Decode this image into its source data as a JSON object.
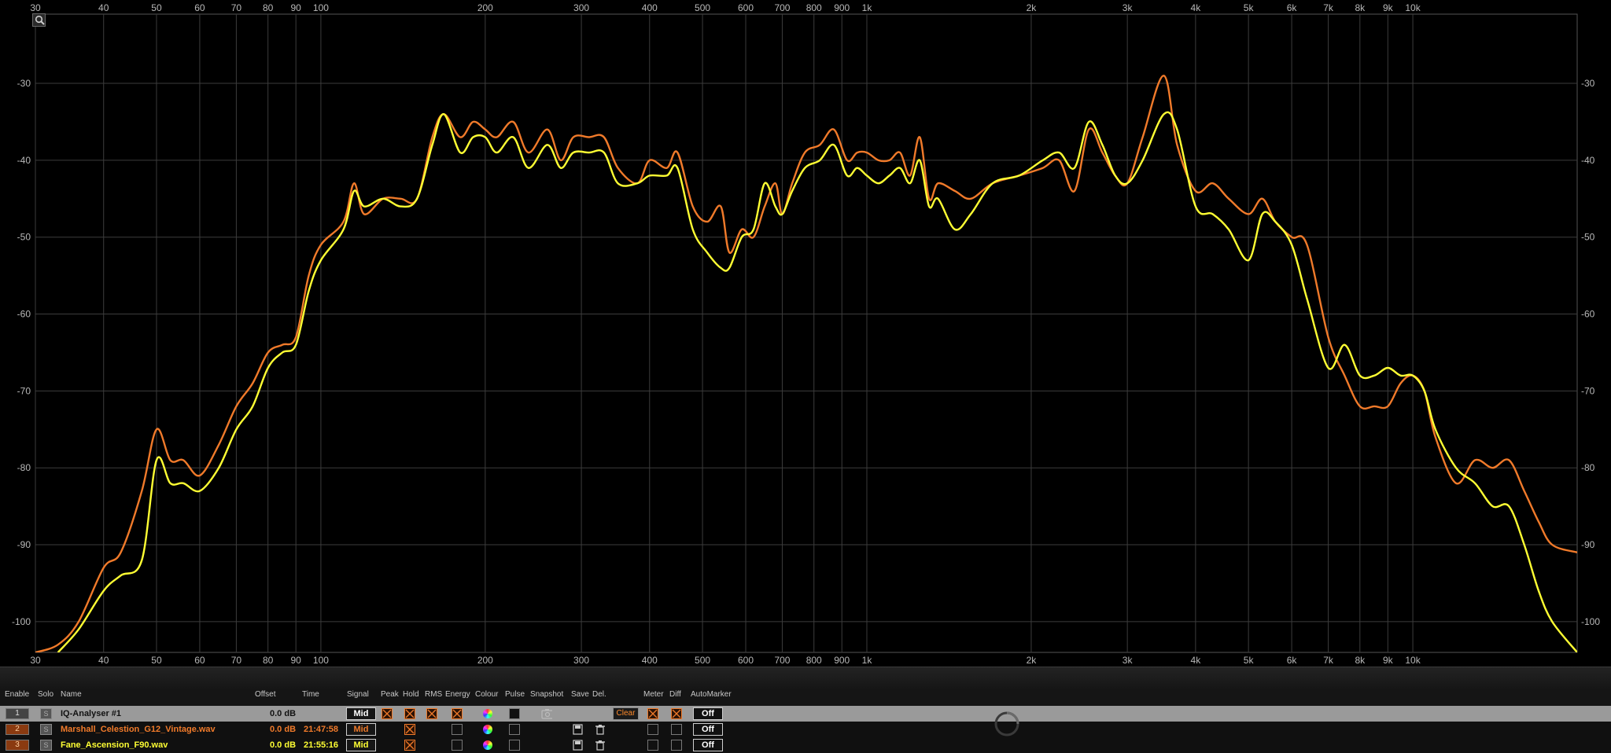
{
  "chart_data": {
    "type": "line",
    "xlabel": "",
    "ylabel": "",
    "x_scale": "log",
    "xlim": [
      30,
      20000
    ],
    "ylim": [
      -104,
      -21
    ],
    "x_ticks": [
      {
        "value": 30,
        "label": "30"
      },
      {
        "value": 40,
        "label": "40"
      },
      {
        "value": 50,
        "label": "50"
      },
      {
        "value": 60,
        "label": "60"
      },
      {
        "value": 70,
        "label": "70"
      },
      {
        "value": 80,
        "label": "80"
      },
      {
        "value": 90,
        "label": "90"
      },
      {
        "value": 100,
        "label": "100"
      },
      {
        "value": 200,
        "label": "200"
      },
      {
        "value": 300,
        "label": "300"
      },
      {
        "value": 400,
        "label": "400"
      },
      {
        "value": 500,
        "label": "500"
      },
      {
        "value": 600,
        "label": "600"
      },
      {
        "value": 700,
        "label": "700"
      },
      {
        "value": 800,
        "label": "800"
      },
      {
        "value": 900,
        "label": "900"
      },
      {
        "value": 1000,
        "label": "1k"
      },
      {
        "value": 2000,
        "label": "2k"
      },
      {
        "value": 3000,
        "label": "3k"
      },
      {
        "value": 4000,
        "label": "4k"
      },
      {
        "value": 5000,
        "label": "5k"
      },
      {
        "value": 6000,
        "label": "6k"
      },
      {
        "value": 7000,
        "label": "7k"
      },
      {
        "value": 8000,
        "label": "8k"
      },
      {
        "value": 9000,
        "label": "9k"
      },
      {
        "value": 10000,
        "label": "10k"
      }
    ],
    "y_ticks": [
      -30,
      -40,
      -50,
      -60,
      -70,
      -80,
      -90,
      -100
    ],
    "grid": true,
    "series": [
      {
        "color": "#f07a2a",
        "points": [
          [
            30,
            -104
          ],
          [
            33,
            -103
          ],
          [
            36,
            -100
          ],
          [
            40,
            -93
          ],
          [
            43,
            -91
          ],
          [
            47,
            -83
          ],
          [
            50,
            -75
          ],
          [
            53,
            -79
          ],
          [
            56,
            -79
          ],
          [
            60,
            -81
          ],
          [
            65,
            -77
          ],
          [
            70,
            -72
          ],
          [
            75,
            -69
          ],
          [
            80,
            -65
          ],
          [
            85,
            -64
          ],
          [
            90,
            -63
          ],
          [
            95,
            -55
          ],
          [
            100,
            -51
          ],
          [
            110,
            -48
          ],
          [
            115,
            -43
          ],
          [
            120,
            -47
          ],
          [
            130,
            -45
          ],
          [
            140,
            -45
          ],
          [
            150,
            -45
          ],
          [
            160,
            -37
          ],
          [
            168,
            -34
          ],
          [
            180,
            -37
          ],
          [
            190,
            -35
          ],
          [
            200,
            -36
          ],
          [
            210,
            -37
          ],
          [
            225,
            -35
          ],
          [
            240,
            -39
          ],
          [
            260,
            -36
          ],
          [
            275,
            -40
          ],
          [
            290,
            -37
          ],
          [
            310,
            -37
          ],
          [
            330,
            -37
          ],
          [
            350,
            -41
          ],
          [
            380,
            -43
          ],
          [
            400,
            -40
          ],
          [
            430,
            -41
          ],
          [
            450,
            -39
          ],
          [
            480,
            -46
          ],
          [
            510,
            -48
          ],
          [
            540,
            -46
          ],
          [
            560,
            -52
          ],
          [
            590,
            -49
          ],
          [
            620,
            -50
          ],
          [
            650,
            -46
          ],
          [
            680,
            -43
          ],
          [
            700,
            -47
          ],
          [
            730,
            -43
          ],
          [
            770,
            -39
          ],
          [
            820,
            -38
          ],
          [
            870,
            -36
          ],
          [
            920,
            -40
          ],
          [
            960,
            -39
          ],
          [
            1000,
            -39
          ],
          [
            1050,
            -40
          ],
          [
            1100,
            -40
          ],
          [
            1150,
            -39
          ],
          [
            1200,
            -42
          ],
          [
            1250,
            -37
          ],
          [
            1300,
            -45
          ],
          [
            1350,
            -43
          ],
          [
            1450,
            -44
          ],
          [
            1550,
            -45
          ],
          [
            1700,
            -43
          ],
          [
            1900,
            -42
          ],
          [
            2100,
            -41
          ],
          [
            2250,
            -40
          ],
          [
            2400,
            -44
          ],
          [
            2550,
            -36
          ],
          [
            2700,
            -39
          ],
          [
            2850,
            -42
          ],
          [
            3000,
            -43
          ],
          [
            3200,
            -37
          ],
          [
            3500,
            -29
          ],
          [
            3700,
            -38
          ],
          [
            4000,
            -44
          ],
          [
            4300,
            -43
          ],
          [
            4600,
            -45
          ],
          [
            5000,
            -47
          ],
          [
            5300,
            -45
          ],
          [
            5600,
            -48
          ],
          [
            6000,
            -50
          ],
          [
            6400,
            -51
          ],
          [
            7000,
            -63
          ],
          [
            7500,
            -68
          ],
          [
            8000,
            -72
          ],
          [
            8500,
            -72
          ],
          [
            9000,
            -72
          ],
          [
            9500,
            -69
          ],
          [
            10000,
            -68
          ],
          [
            10500,
            -70
          ],
          [
            11000,
            -76
          ],
          [
            12000,
            -82
          ],
          [
            13000,
            -79
          ],
          [
            14000,
            -80
          ],
          [
            15000,
            -79
          ],
          [
            16000,
            -83
          ],
          [
            17000,
            -87
          ],
          [
            18000,
            -90
          ],
          [
            20000,
            -91
          ]
        ]
      },
      {
        "color": "#ffff33",
        "points": [
          [
            33,
            -104
          ],
          [
            36,
            -101
          ],
          [
            40,
            -96
          ],
          [
            43,
            -94
          ],
          [
            47,
            -92
          ],
          [
            50,
            -79
          ],
          [
            53,
            -82
          ],
          [
            56,
            -82
          ],
          [
            60,
            -83
          ],
          [
            65,
            -80
          ],
          [
            70,
            -75
          ],
          [
            75,
            -72
          ],
          [
            80,
            -67
          ],
          [
            85,
            -65
          ],
          [
            90,
            -64
          ],
          [
            95,
            -57
          ],
          [
            100,
            -53
          ],
          [
            110,
            -49
          ],
          [
            115,
            -44
          ],
          [
            120,
            -46
          ],
          [
            130,
            -45
          ],
          [
            140,
            -46
          ],
          [
            150,
            -45
          ],
          [
            160,
            -38
          ],
          [
            168,
            -34
          ],
          [
            180,
            -39
          ],
          [
            190,
            -37
          ],
          [
            200,
            -37
          ],
          [
            210,
            -39
          ],
          [
            225,
            -37
          ],
          [
            240,
            -41
          ],
          [
            260,
            -38
          ],
          [
            275,
            -41
          ],
          [
            290,
            -39
          ],
          [
            310,
            -39
          ],
          [
            330,
            -39
          ],
          [
            350,
            -43
          ],
          [
            380,
            -43
          ],
          [
            400,
            -42
          ],
          [
            430,
            -42
          ],
          [
            450,
            -41
          ],
          [
            480,
            -49
          ],
          [
            510,
            -52
          ],
          [
            540,
            -54
          ],
          [
            560,
            -54
          ],
          [
            590,
            -50
          ],
          [
            620,
            -49
          ],
          [
            650,
            -43
          ],
          [
            680,
            -46
          ],
          [
            700,
            -47
          ],
          [
            730,
            -44
          ],
          [
            770,
            -41
          ],
          [
            820,
            -40
          ],
          [
            870,
            -38
          ],
          [
            920,
            -42
          ],
          [
            960,
            -41
          ],
          [
            1000,
            -42
          ],
          [
            1050,
            -43
          ],
          [
            1100,
            -42
          ],
          [
            1150,
            -41
          ],
          [
            1200,
            -43
          ],
          [
            1250,
            -40
          ],
          [
            1300,
            -46
          ],
          [
            1350,
            -45
          ],
          [
            1450,
            -49
          ],
          [
            1550,
            -47
          ],
          [
            1700,
            -43
          ],
          [
            1900,
            -42
          ],
          [
            2100,
            -40
          ],
          [
            2250,
            -39
          ],
          [
            2400,
            -41
          ],
          [
            2550,
            -35
          ],
          [
            2700,
            -38
          ],
          [
            2850,
            -42
          ],
          [
            3000,
            -43
          ],
          [
            3200,
            -40
          ],
          [
            3500,
            -34
          ],
          [
            3700,
            -36
          ],
          [
            4000,
            -46
          ],
          [
            4300,
            -47
          ],
          [
            4600,
            -49
          ],
          [
            5000,
            -53
          ],
          [
            5300,
            -47
          ],
          [
            5600,
            -48
          ],
          [
            6000,
            -51
          ],
          [
            6400,
            -58
          ],
          [
            7000,
            -67
          ],
          [
            7500,
            -64
          ],
          [
            8000,
            -68
          ],
          [
            8500,
            -68
          ],
          [
            9000,
            -67
          ],
          [
            9500,
            -68
          ],
          [
            10000,
            -68
          ],
          [
            10500,
            -70
          ],
          [
            11000,
            -75
          ],
          [
            12000,
            -80
          ],
          [
            13000,
            -82
          ],
          [
            14000,
            -85
          ],
          [
            15000,
            -85
          ],
          [
            16000,
            -90
          ],
          [
            17000,
            -96
          ],
          [
            18000,
            -100
          ],
          [
            20000,
            -104
          ]
        ]
      }
    ]
  },
  "table": {
    "headers": [
      {
        "key": "enable",
        "label": "Enable"
      },
      {
        "key": "solo",
        "label": "Solo"
      },
      {
        "key": "name",
        "label": "Name"
      },
      {
        "key": "offset",
        "label": "Offset"
      },
      {
        "key": "time",
        "label": "Time"
      },
      {
        "key": "signal",
        "label": "Signal"
      },
      {
        "key": "peak",
        "label": "Peak"
      },
      {
        "key": "hold",
        "label": "Hold"
      },
      {
        "key": "rms",
        "label": "RMS"
      },
      {
        "key": "energy",
        "label": "Energy"
      },
      {
        "key": "colour",
        "label": "Colour"
      },
      {
        "key": "pulse",
        "label": "Pulse"
      },
      {
        "key": "snapshot",
        "label": "Snapshot"
      },
      {
        "key": "save",
        "label": "Save"
      },
      {
        "key": "del",
        "label": "Del."
      },
      {
        "key": "meter",
        "label": "Meter"
      },
      {
        "key": "diff",
        "label": "Diff"
      },
      {
        "key": "automarker",
        "label": "AutoMarker"
      }
    ],
    "rows": [
      {
        "index": "1",
        "solo": "S",
        "name": "IQ-Analyser #1",
        "offset": "0.0 dB",
        "time": "",
        "signal": "Mid",
        "color": "#ffffff",
        "clear": "Clear",
        "automarker": "Off"
      },
      {
        "index": "2",
        "solo": "S",
        "name": "Marshall_Celestion_G12_Vintage.wav",
        "offset": "0.0 dB",
        "time": "21:47:58",
        "signal": "Mid",
        "color": "#f07a2a",
        "automarker": "Off"
      },
      {
        "index": "3",
        "solo": "S",
        "name": "Fane_Ascension_F90.wav",
        "offset": "0.0 dB",
        "time": "21:55:16",
        "signal": "Mid",
        "color": "#ffff33",
        "automarker": "Off"
      }
    ]
  }
}
